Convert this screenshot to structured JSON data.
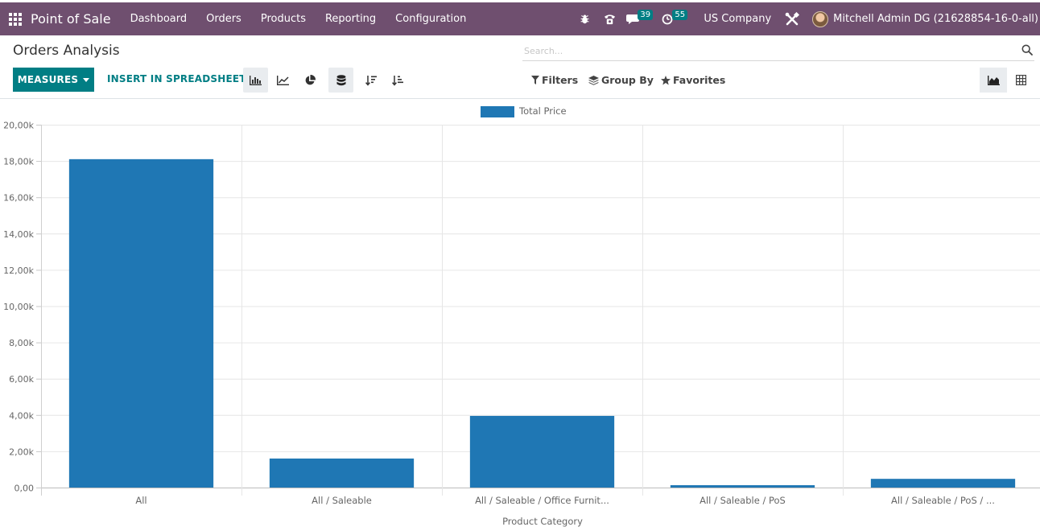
{
  "navbar": {
    "brand": "Point of Sale",
    "menu": [
      "Dashboard",
      "Orders",
      "Products",
      "Reporting",
      "Configuration"
    ],
    "messages_count": "39",
    "activities_count": "55",
    "company": "US Company",
    "user": "Mitchell Admin DG (21628854-16-0-all)"
  },
  "control_panel": {
    "title": "Orders Analysis",
    "search_placeholder": "Search...",
    "measures_label": "MEASURES",
    "insert_label": "INSERT IN SPREADSHEET",
    "filters_label": "Filters",
    "groupby_label": "Group By",
    "favorites_label": "Favorites"
  },
  "colors": {
    "navbar": "#6f4f6f",
    "primary": "#017e84",
    "bar": "#1f77b4"
  },
  "chart_data": {
    "type": "bar",
    "categories": [
      "All",
      "All / Saleable",
      "All / Saleable / Office Furnit...",
      "All / Saleable / PoS",
      "All / Saleable / PoS / ..."
    ],
    "series": [
      {
        "name": "Total Price",
        "values": [
          18100,
          1600,
          3950,
          130,
          480
        ]
      }
    ],
    "ylim": [
      0,
      20000
    ],
    "yticks": [
      0,
      2000,
      4000,
      6000,
      8000,
      10000,
      12000,
      14000,
      16000,
      18000,
      20000
    ],
    "ytick_labels": [
      "0,00",
      "2,00k",
      "4,00k",
      "6,00k",
      "8,00k",
      "10,00k",
      "12,00k",
      "14,00k",
      "16,00k",
      "18,00k",
      "20,00k"
    ],
    "xlabel": "Product Category",
    "ylabel": "",
    "legend_position": "top-center",
    "grid": true
  }
}
